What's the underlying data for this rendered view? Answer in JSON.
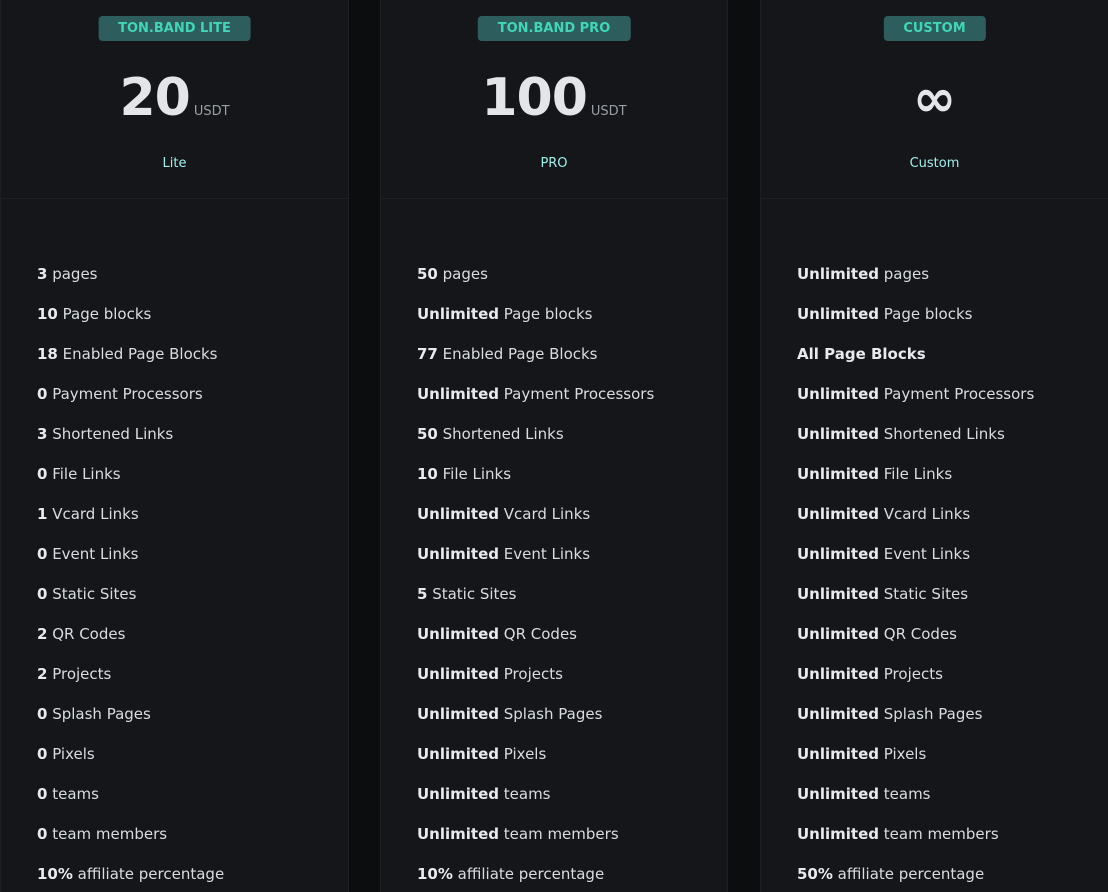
{
  "plans": [
    {
      "badge": "TON.BAND LITE",
      "amount": "20",
      "currency": "USDT",
      "name": "Lite",
      "features": [
        {
          "value": "3",
          "label": " pages"
        },
        {
          "value": "10",
          "label": " Page blocks"
        },
        {
          "value": "18",
          "label": " Enabled Page Blocks"
        },
        {
          "value": "0",
          "label": " Payment Processors"
        },
        {
          "value": "3",
          "label": " Shortened Links"
        },
        {
          "value": "0",
          "label": " File Links"
        },
        {
          "value": "1",
          "label": " Vcard Links"
        },
        {
          "value": "0",
          "label": " Event Links"
        },
        {
          "value": "0",
          "label": " Static Sites"
        },
        {
          "value": "2",
          "label": " QR Codes"
        },
        {
          "value": "2",
          "label": " Projects"
        },
        {
          "value": "0",
          "label": " Splash Pages"
        },
        {
          "value": "0",
          "label": " Pixels"
        },
        {
          "value": "0",
          "label": " teams"
        },
        {
          "value": "0",
          "label": " team members"
        },
        {
          "value": "10%",
          "label": " affiliate percentage"
        }
      ]
    },
    {
      "badge": "TON.BAND PRO",
      "amount": "100",
      "currency": "USDT",
      "name": "PRO",
      "features": [
        {
          "value": "50",
          "label": " pages"
        },
        {
          "value": "Unlimited",
          "label": " Page blocks"
        },
        {
          "value": "77",
          "label": " Enabled Page Blocks"
        },
        {
          "value": "Unlimited",
          "label": " Payment Processors"
        },
        {
          "value": "50",
          "label": " Shortened Links"
        },
        {
          "value": "10",
          "label": " File Links"
        },
        {
          "value": "Unlimited",
          "label": " Vcard Links"
        },
        {
          "value": "Unlimited",
          "label": " Event Links"
        },
        {
          "value": "5",
          "label": " Static Sites"
        },
        {
          "value": "Unlimited",
          "label": " QR Codes"
        },
        {
          "value": "Unlimited",
          "label": " Projects"
        },
        {
          "value": "Unlimited",
          "label": " Splash Pages"
        },
        {
          "value": "Unlimited",
          "label": " Pixels"
        },
        {
          "value": "Unlimited",
          "label": " teams"
        },
        {
          "value": "Unlimited",
          "label": " team members"
        },
        {
          "value": "10%",
          "label": " affiliate percentage"
        }
      ]
    },
    {
      "badge": "CUSTOM",
      "amount": "∞",
      "currency": "",
      "name": "Custom",
      "features": [
        {
          "value": "Unlimited",
          "label": " pages"
        },
        {
          "value": "Unlimited",
          "label": " Page blocks"
        },
        {
          "value": "All Page Blocks",
          "label": ""
        },
        {
          "value": "Unlimited",
          "label": " Payment Processors"
        },
        {
          "value": "Unlimited",
          "label": " Shortened Links"
        },
        {
          "value": "Unlimited",
          "label": " File Links"
        },
        {
          "value": "Unlimited",
          "label": " Vcard Links"
        },
        {
          "value": "Unlimited",
          "label": " Event Links"
        },
        {
          "value": "Unlimited",
          "label": " Static Sites"
        },
        {
          "value": "Unlimited",
          "label": " QR Codes"
        },
        {
          "value": "Unlimited",
          "label": " Projects"
        },
        {
          "value": "Unlimited",
          "label": " Splash Pages"
        },
        {
          "value": "Unlimited",
          "label": " Pixels"
        },
        {
          "value": "Unlimited",
          "label": " teams"
        },
        {
          "value": "Unlimited",
          "label": " team members"
        },
        {
          "value": "50%",
          "label": " affiliate percentage"
        }
      ]
    }
  ],
  "colors": {
    "background": "#0c0d0e",
    "card": "#141619",
    "badge_bg": "#2d5d5d",
    "badge_text": "#41d6b8",
    "plan_name": "#9ff0ea"
  }
}
